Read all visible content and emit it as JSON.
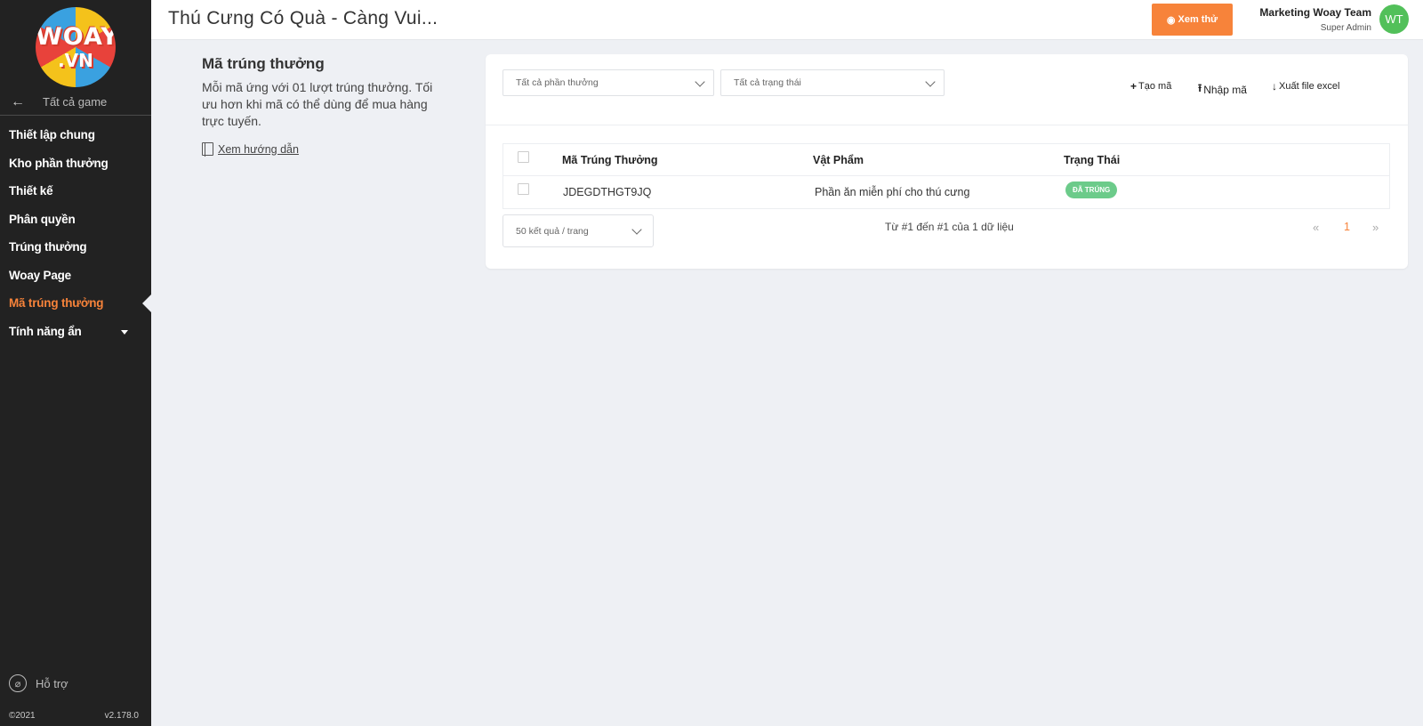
{
  "sidebar": {
    "logo_text": "WOAY",
    "logo_sub": ".VN",
    "back_label": "Tất cả game",
    "items": [
      {
        "label": "Thiết lập chung"
      },
      {
        "label": "Kho phần thưởng"
      },
      {
        "label": "Thiết kế"
      },
      {
        "label": "Phân quyền"
      },
      {
        "label": "Trúng thưởng"
      },
      {
        "label": "Woay Page"
      },
      {
        "label": "Mã trúng thưởng"
      },
      {
        "label": "Tính năng ẩn"
      }
    ],
    "active_item": "Mã trúng thưởng",
    "support_label": "Hỗ trợ",
    "copyright": "©2021",
    "version": "v2.178.0"
  },
  "header": {
    "title": "Thú Cưng Có Quà - Càng Vui...",
    "try_button": "Xem thử",
    "user_name": "Marketing Woay Team",
    "user_role": "Super Admin",
    "avatar_initials": "WT"
  },
  "info": {
    "title": "Mã trúng thưởng",
    "description": "Mỗi mã ứng với 01 lượt trúng thưởng. Tối ưu hơn khi mã có thể dùng để mua hàng trực tuyến.",
    "guide_link": "Xem hướng dẫn"
  },
  "filters": {
    "reward": "Tất cả phần thưởng",
    "status": "Tất cả trạng thái"
  },
  "actions": {
    "create": "Tạo mã",
    "import": "Nhập mã",
    "export": "Xuất file excel"
  },
  "table": {
    "headers": [
      "Mã Trúng Thưởng",
      "Vật Phẩm",
      "Trạng Thái"
    ],
    "rows": [
      {
        "code": "JDEGDTHGT9JQ",
        "item": "Phần ăn miễn phí cho thú cưng",
        "status": "ĐÃ TRÚNG"
      }
    ]
  },
  "pagination": {
    "per_page": "50 kết quả / trang",
    "summary": "Từ #1 đến #1 của 1 dữ liệu",
    "prev": "«",
    "current": "1",
    "next": "»"
  },
  "colors": {
    "accent": "#f7833a",
    "sidebar_bg": "#222222",
    "badge_green": "#6ccb8a",
    "avatar_green": "#52c05a"
  }
}
